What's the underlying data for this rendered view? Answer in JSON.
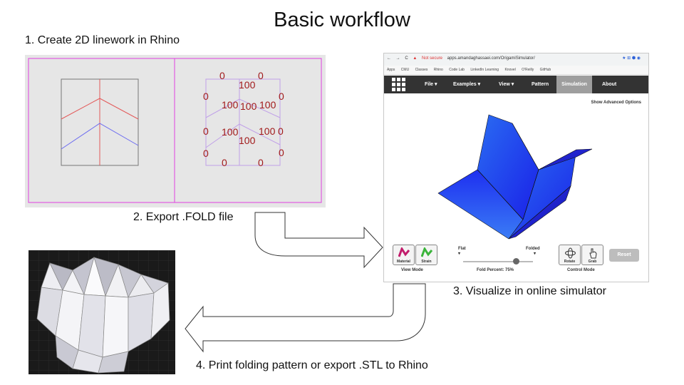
{
  "title": "Basic workflow",
  "steps": {
    "s1": "1. Create 2D linework in Rhino",
    "s2": "2. Export .FOLD file",
    "s3": "3. Visualize in online simulator",
    "s4": "4. Print folding pattern or export .STL to Rhino"
  },
  "crease_angles": [
    "0",
    "0",
    "100",
    "0",
    "0",
    "100",
    "100",
    "100",
    "0",
    "100",
    "100",
    "0",
    "100",
    "0",
    "0",
    "0"
  ],
  "browser": {
    "not_secure": "Not secure",
    "url": "apps.amandaghassaei.com/OrigamiSimulator/",
    "bookmarks": [
      "Apps",
      "CMU",
      "Classes",
      "Rhino",
      "Code Lab",
      "LinkedIn Learning",
      "Knovel",
      "O'Reilly",
      "GitHub"
    ],
    "nav": [
      "File ▾",
      "Examples ▾",
      "View ▾",
      "Pattern",
      "Simulation",
      "About"
    ],
    "show_advanced": "Show Advanced Options",
    "material": "Material",
    "strain": "Strain",
    "view_mode": "View Mode",
    "flat": "Flat",
    "folded": "Folded",
    "fold_percent_label": "Fold Percent: 75%",
    "fold_percent": 0.75,
    "rotate": "Rotate",
    "grab": "Grab",
    "control_mode": "Control Mode",
    "reset": "Reset"
  },
  "colors": {
    "mountain_fold": "#e35a5a",
    "valley_fold": "#6b6bf0",
    "crease_label": "#a11a1a",
    "guide_line": "#e040e0",
    "model_blue": "#1e3cf0"
  }
}
